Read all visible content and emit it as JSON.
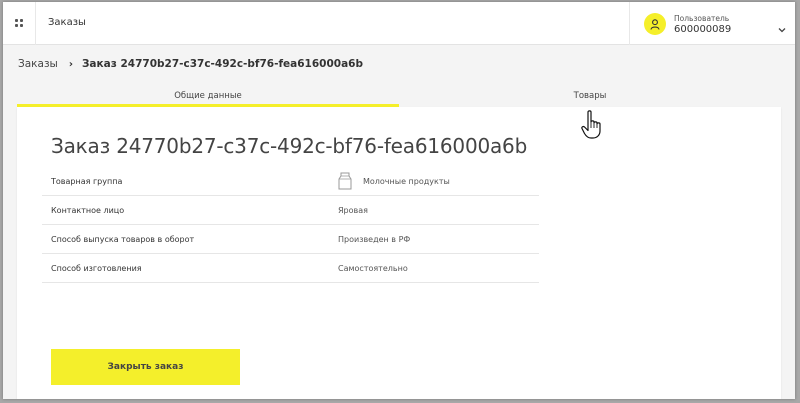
{
  "header": {
    "title": "Заказы",
    "user": {
      "label": "Пользователь",
      "id": "600000089"
    }
  },
  "breadcrumb": {
    "parent": "Заказы",
    "current": "Заказ 24770b27-c37c-492c-bf76-fea616000a6b"
  },
  "tabs": [
    {
      "label": "Общие данные",
      "active": true
    },
    {
      "label": "Товары",
      "active": false
    }
  ],
  "order": {
    "title": "Заказ 24770b27-c37c-492c-bf76-fea616000a6b",
    "fields": [
      {
        "label": "Товарная группа",
        "value": "Молочные продукты",
        "icon": "milk-carton-icon"
      },
      {
        "label": "Контактное лицо",
        "value": "Яровая"
      },
      {
        "label": "Способ выпуска товаров в оборот",
        "value": "Произведен в РФ"
      },
      {
        "label": "Способ изготовления",
        "value": "Самостоятельно"
      }
    ],
    "close_button": "Закрыть заказ"
  },
  "colors": {
    "accent": "#f5ef2a"
  }
}
